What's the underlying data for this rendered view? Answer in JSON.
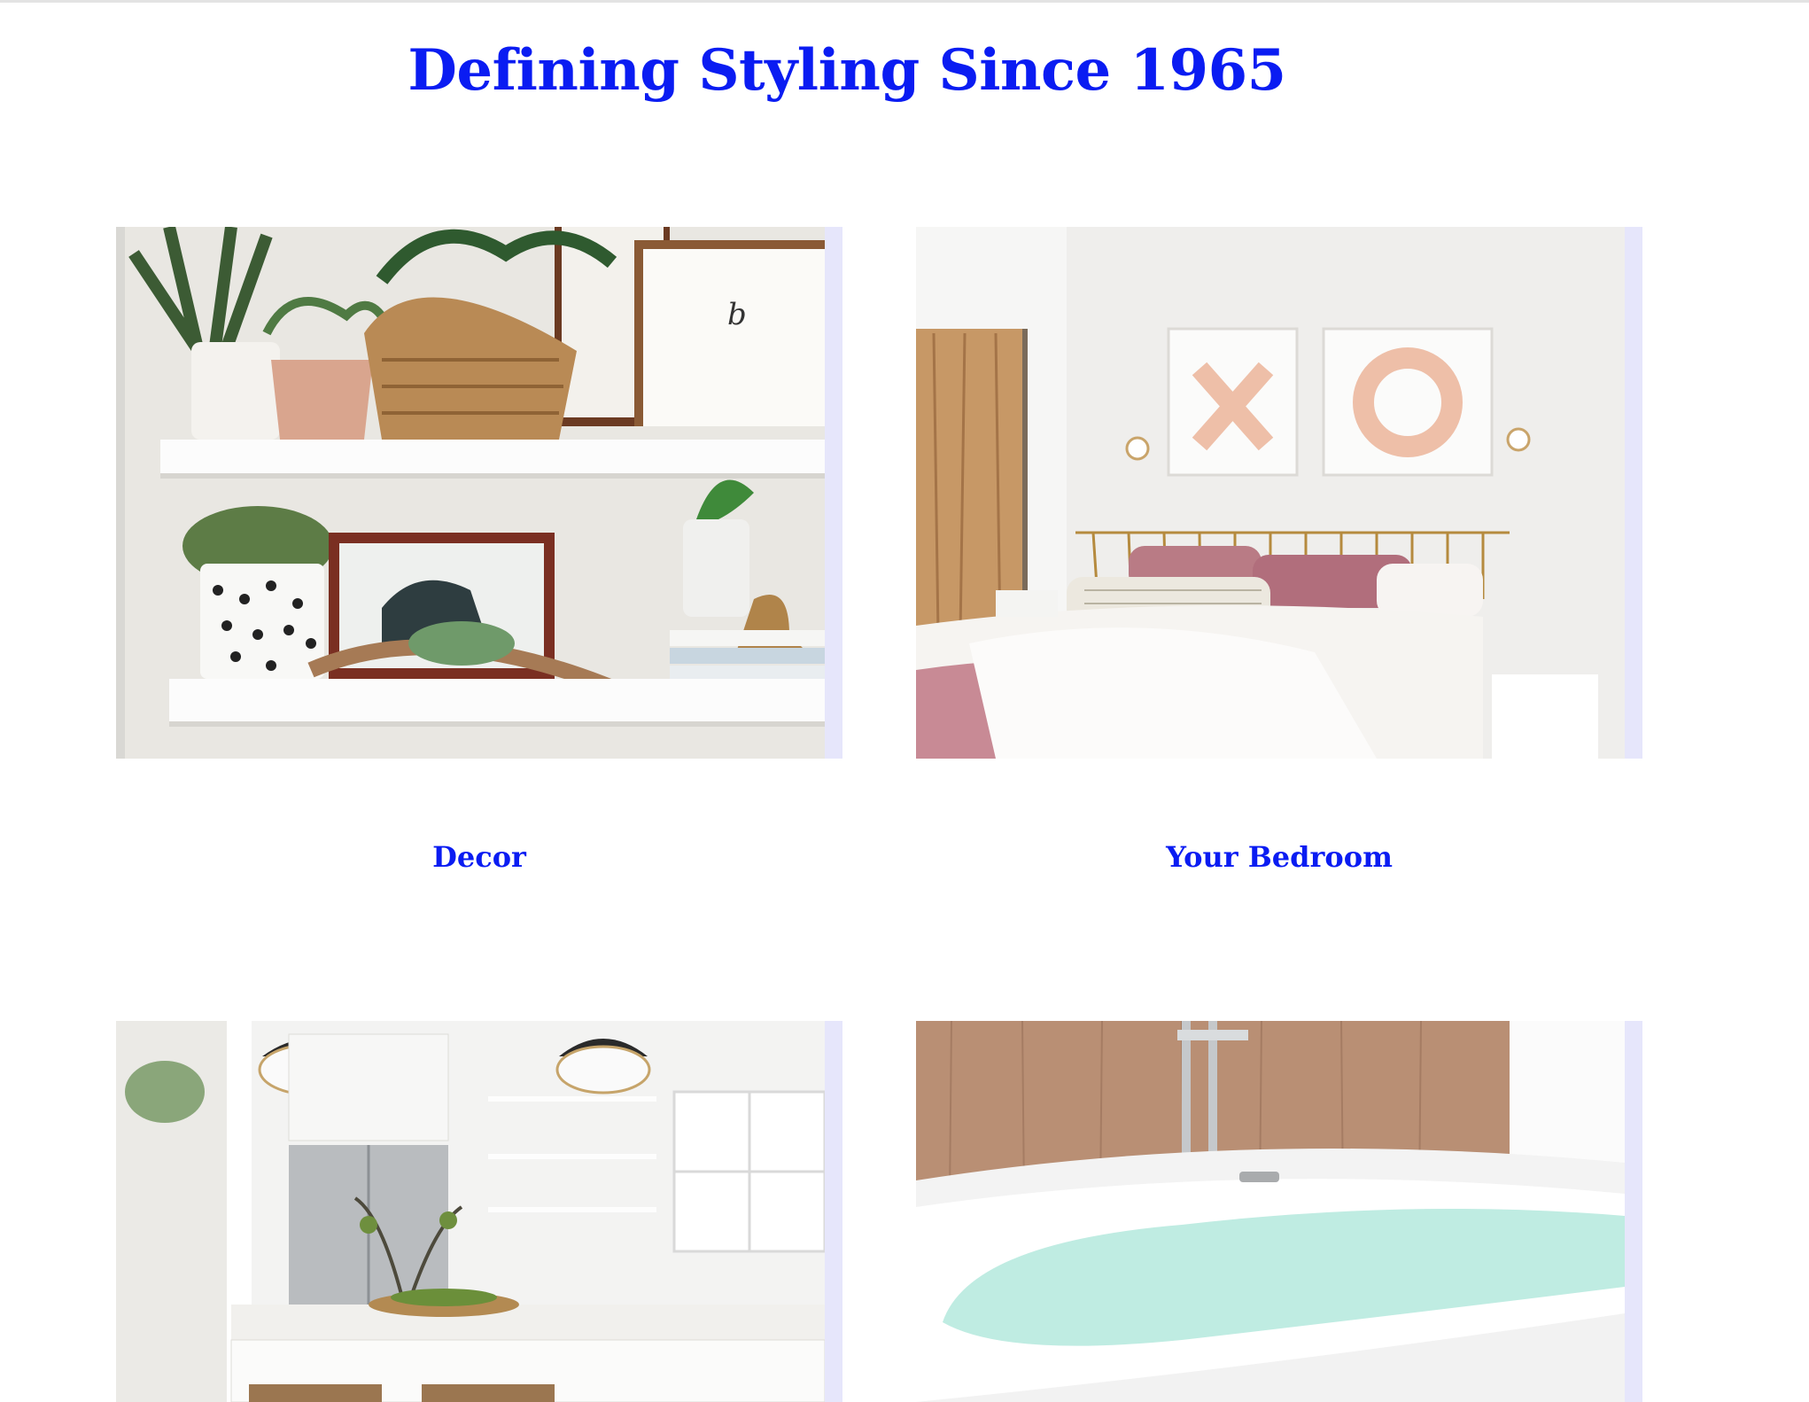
{
  "header": {
    "title": "Defining Styling Since 1965"
  },
  "gallery": {
    "items": [
      {
        "label": "Decor",
        "image": "decor-shelves-photo"
      },
      {
        "label": "Your Bedroom",
        "image": "bedroom-photo"
      },
      {
        "label": "",
        "image": "kitchen-photo"
      },
      {
        "label": "",
        "image": "bathtub-photo"
      }
    ]
  },
  "colors": {
    "title": "#0a1cf2",
    "card_background": "#e6e6fb",
    "top_rule": "#e3e3e3"
  }
}
